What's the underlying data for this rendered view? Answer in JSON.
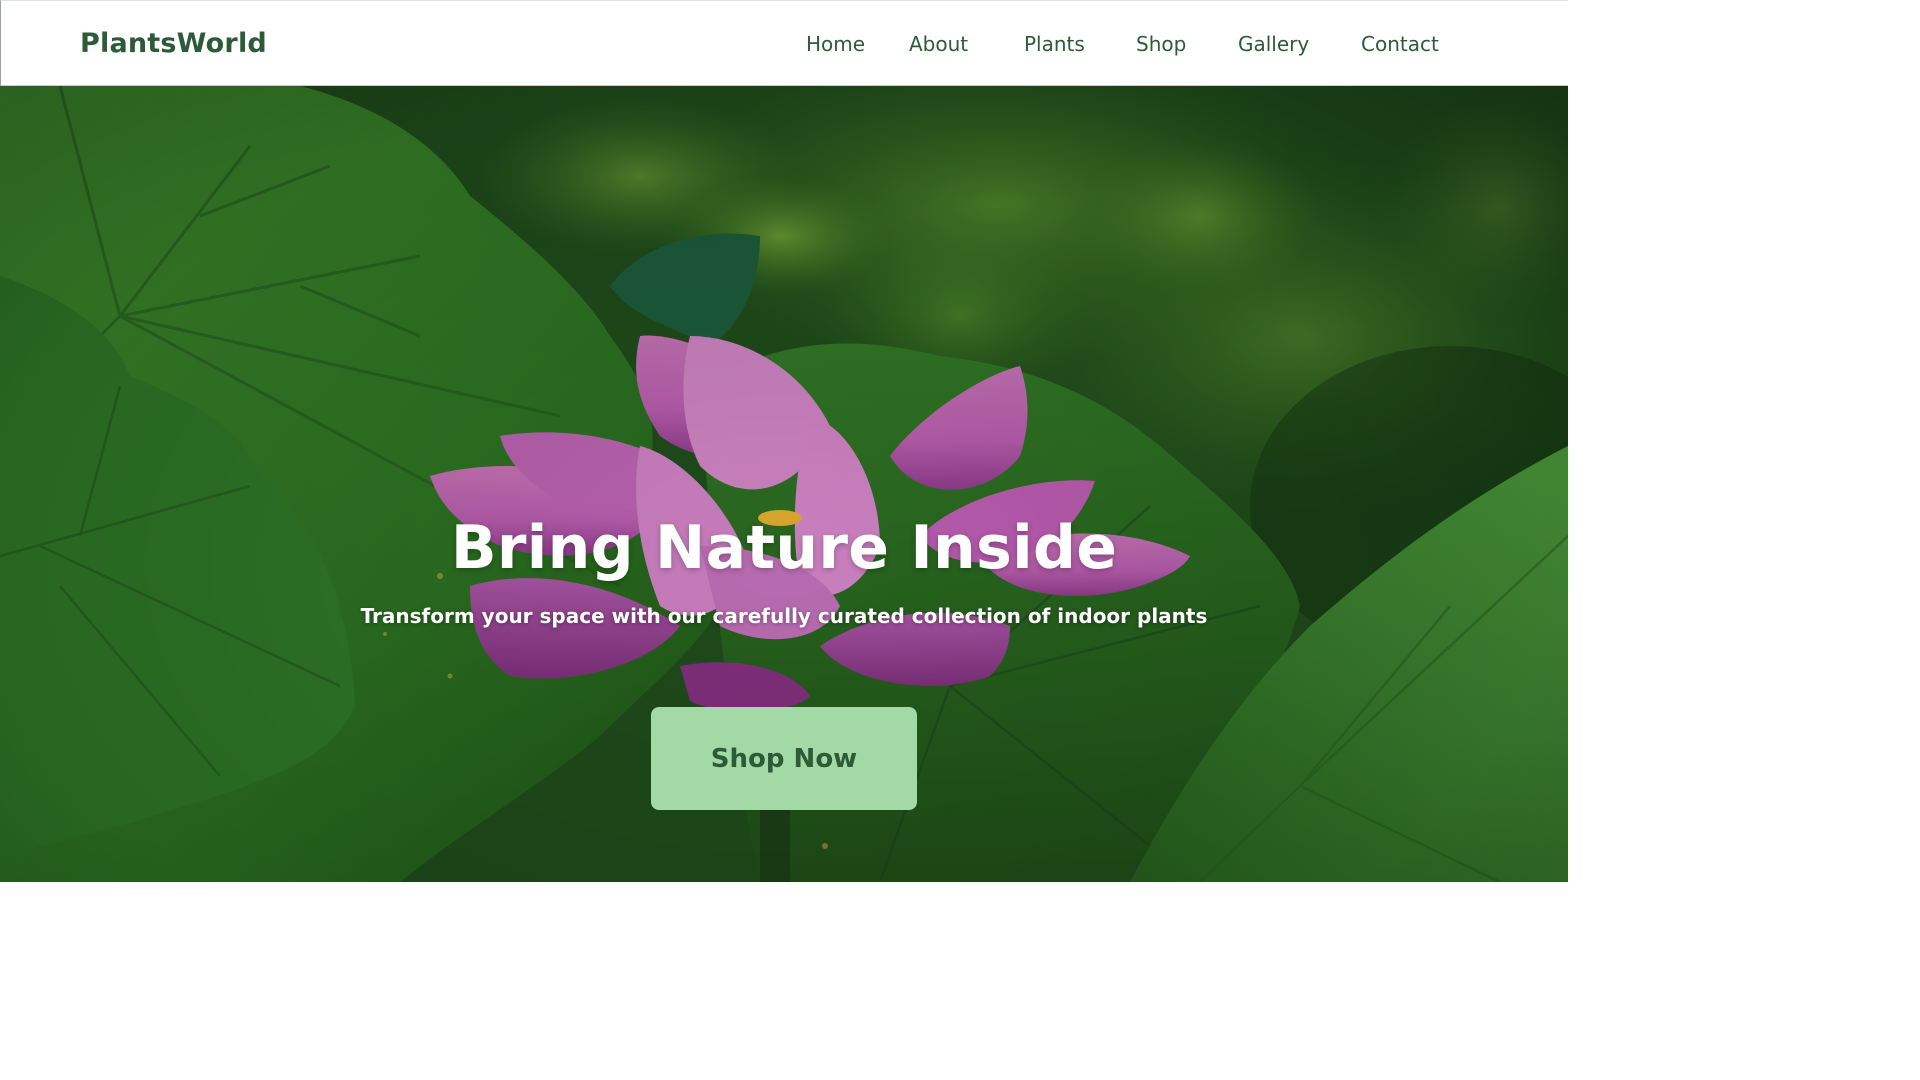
{
  "header": {
    "logo": "PlantsWorld",
    "nav": [
      {
        "label": "Home"
      },
      {
        "label": "About"
      },
      {
        "label": "Plants"
      },
      {
        "label": "Shop"
      },
      {
        "label": "Gallery"
      },
      {
        "label": "Contact"
      }
    ]
  },
  "hero": {
    "title": "Bring Nature Inside",
    "subtitle": "Transform your space with our carefully curated collection of indoor plants",
    "cta_label": "Shop Now",
    "background_image": "pink lotus flower among large green leaves"
  },
  "colors": {
    "brand_green": "#2d5a38",
    "cta_background": "#a3d9a5",
    "header_background": "#ffffff",
    "hero_text": "#ffffff"
  }
}
